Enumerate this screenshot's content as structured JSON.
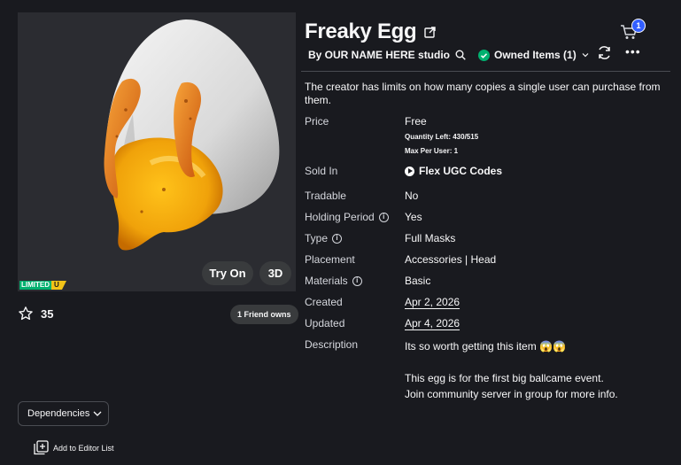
{
  "item": {
    "title": "Freaky Egg",
    "creator": "By OUR NAME HERE studio",
    "owned": "Owned Items (1)",
    "cart_count": "1",
    "notice": "The creator has limits on how many copies a single user can purchase from them."
  },
  "preview": {
    "limited_label": "LIMITED",
    "limited_u": "U",
    "try_on": "Try On",
    "three_d": "3D"
  },
  "social": {
    "favorites": "35",
    "friends_own": "1 Friend owns"
  },
  "details": {
    "price_label": "Price",
    "price_value": "Free",
    "quantity_left": "Quantity Left: 430/515",
    "max_per_user": "Max Per User: 1",
    "sold_in_label": "Sold In",
    "sold_in_value": "Flex UGC Codes",
    "tradable_label": "Tradable",
    "tradable_value": "No",
    "holding_label": "Holding Period",
    "holding_value": "Yes",
    "type_label": "Type",
    "type_value": "Full Masks",
    "placement_label": "Placement",
    "placement_value": "Accessories | Head",
    "materials_label": "Materials",
    "materials_value": "Basic",
    "created_label": "Created",
    "created_value": "Apr 2, 2026",
    "updated_label": "Updated",
    "updated_value": "Apr 4, 2026",
    "description_label": "Description",
    "description_line1": "Its so worth getting this item 😱😱",
    "description_line2": "This egg is for the first big ballcame event.",
    "description_line3": "Join community server in group for more info."
  },
  "bottom": {
    "dependencies": "Dependencies",
    "add_editor": "Add to Editor List"
  },
  "colors": {
    "background": "#191a1f",
    "preview_bg": "#2b2c31",
    "limited_green": "#00b06f",
    "limited_yellow": "#f2c318",
    "owned_check": "#00b06f",
    "badge_blue": "#335fff"
  }
}
